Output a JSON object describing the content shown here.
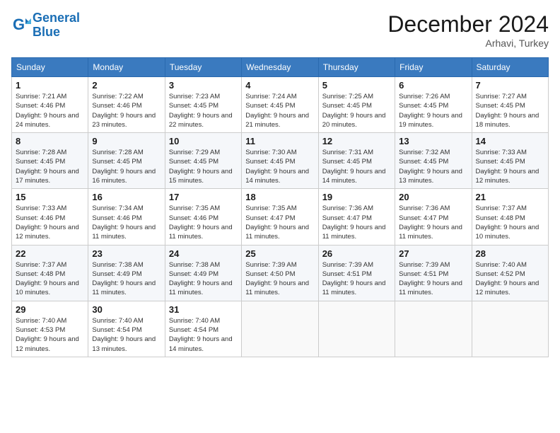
{
  "logo": {
    "line1": "General",
    "line2": "Blue"
  },
  "title": "December 2024",
  "location": "Arhavi, Turkey",
  "days_header": [
    "Sunday",
    "Monday",
    "Tuesday",
    "Wednesday",
    "Thursday",
    "Friday",
    "Saturday"
  ],
  "weeks": [
    [
      {
        "day": "1",
        "sunrise": "7:21 AM",
        "sunset": "4:46 PM",
        "daylight": "9 hours and 24 minutes."
      },
      {
        "day": "2",
        "sunrise": "7:22 AM",
        "sunset": "4:46 PM",
        "daylight": "9 hours and 23 minutes."
      },
      {
        "day": "3",
        "sunrise": "7:23 AM",
        "sunset": "4:45 PM",
        "daylight": "9 hours and 22 minutes."
      },
      {
        "day": "4",
        "sunrise": "7:24 AM",
        "sunset": "4:45 PM",
        "daylight": "9 hours and 21 minutes."
      },
      {
        "day": "5",
        "sunrise": "7:25 AM",
        "sunset": "4:45 PM",
        "daylight": "9 hours and 20 minutes."
      },
      {
        "day": "6",
        "sunrise": "7:26 AM",
        "sunset": "4:45 PM",
        "daylight": "9 hours and 19 minutes."
      },
      {
        "day": "7",
        "sunrise": "7:27 AM",
        "sunset": "4:45 PM",
        "daylight": "9 hours and 18 minutes."
      }
    ],
    [
      {
        "day": "8",
        "sunrise": "7:28 AM",
        "sunset": "4:45 PM",
        "daylight": "9 hours and 17 minutes."
      },
      {
        "day": "9",
        "sunrise": "7:28 AM",
        "sunset": "4:45 PM",
        "daylight": "9 hours and 16 minutes."
      },
      {
        "day": "10",
        "sunrise": "7:29 AM",
        "sunset": "4:45 PM",
        "daylight": "9 hours and 15 minutes."
      },
      {
        "day": "11",
        "sunrise": "7:30 AM",
        "sunset": "4:45 PM",
        "daylight": "9 hours and 14 minutes."
      },
      {
        "day": "12",
        "sunrise": "7:31 AM",
        "sunset": "4:45 PM",
        "daylight": "9 hours and 14 minutes."
      },
      {
        "day": "13",
        "sunrise": "7:32 AM",
        "sunset": "4:45 PM",
        "daylight": "9 hours and 13 minutes."
      },
      {
        "day": "14",
        "sunrise": "7:33 AM",
        "sunset": "4:45 PM",
        "daylight": "9 hours and 12 minutes."
      }
    ],
    [
      {
        "day": "15",
        "sunrise": "7:33 AM",
        "sunset": "4:46 PM",
        "daylight": "9 hours and 12 minutes."
      },
      {
        "day": "16",
        "sunrise": "7:34 AM",
        "sunset": "4:46 PM",
        "daylight": "9 hours and 11 minutes."
      },
      {
        "day": "17",
        "sunrise": "7:35 AM",
        "sunset": "4:46 PM",
        "daylight": "9 hours and 11 minutes."
      },
      {
        "day": "18",
        "sunrise": "7:35 AM",
        "sunset": "4:47 PM",
        "daylight": "9 hours and 11 minutes."
      },
      {
        "day": "19",
        "sunrise": "7:36 AM",
        "sunset": "4:47 PM",
        "daylight": "9 hours and 11 minutes."
      },
      {
        "day": "20",
        "sunrise": "7:36 AM",
        "sunset": "4:47 PM",
        "daylight": "9 hours and 11 minutes."
      },
      {
        "day": "21",
        "sunrise": "7:37 AM",
        "sunset": "4:48 PM",
        "daylight": "9 hours and 10 minutes."
      }
    ],
    [
      {
        "day": "22",
        "sunrise": "7:37 AM",
        "sunset": "4:48 PM",
        "daylight": "9 hours and 10 minutes."
      },
      {
        "day": "23",
        "sunrise": "7:38 AM",
        "sunset": "4:49 PM",
        "daylight": "9 hours and 11 minutes."
      },
      {
        "day": "24",
        "sunrise": "7:38 AM",
        "sunset": "4:49 PM",
        "daylight": "9 hours and 11 minutes."
      },
      {
        "day": "25",
        "sunrise": "7:39 AM",
        "sunset": "4:50 PM",
        "daylight": "9 hours and 11 minutes."
      },
      {
        "day": "26",
        "sunrise": "7:39 AM",
        "sunset": "4:51 PM",
        "daylight": "9 hours and 11 minutes."
      },
      {
        "day": "27",
        "sunrise": "7:39 AM",
        "sunset": "4:51 PM",
        "daylight": "9 hours and 11 minutes."
      },
      {
        "day": "28",
        "sunrise": "7:40 AM",
        "sunset": "4:52 PM",
        "daylight": "9 hours and 12 minutes."
      }
    ],
    [
      {
        "day": "29",
        "sunrise": "7:40 AM",
        "sunset": "4:53 PM",
        "daylight": "9 hours and 12 minutes."
      },
      {
        "day": "30",
        "sunrise": "7:40 AM",
        "sunset": "4:54 PM",
        "daylight": "9 hours and 13 minutes."
      },
      {
        "day": "31",
        "sunrise": "7:40 AM",
        "sunset": "4:54 PM",
        "daylight": "9 hours and 14 minutes."
      },
      null,
      null,
      null,
      null
    ]
  ]
}
